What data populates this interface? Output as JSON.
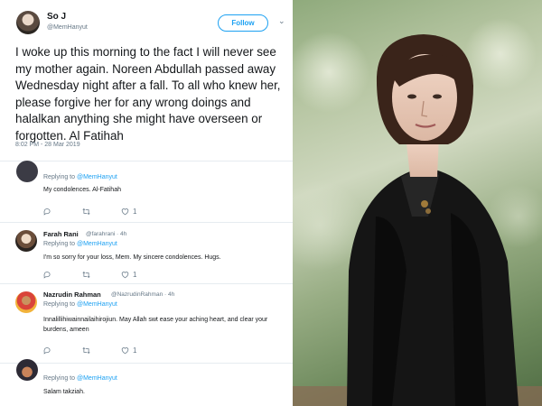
{
  "tweet": {
    "display_name": "So J",
    "handle": "@MemHanyut",
    "follow_label": "Follow",
    "text": "I woke up this morning to the fact I will never see my mother again. Noreen Abdullah passed away Wednesday night after a fall. To all who knew her, please forgive her for any wrong doings and halalkan anything she might have overseen or forgotten. Al Fatihah",
    "timestamp": "8:02 PM - 28 Mar 2019"
  },
  "replies": [
    {
      "name": "",
      "handle": "",
      "replying_prefix": "Replying to",
      "replying_to": "@MemHanyut",
      "text": "My condolences. Al-Fatihah",
      "like_count": "1"
    },
    {
      "name": "Farah Rani",
      "handle": "@farahrani · 4h",
      "replying_prefix": "Replying to",
      "replying_to": "@MemHanyut",
      "text": "I'm so sorry for your loss, Mem. My sincere condolences. Hugs.",
      "like_count": "1"
    },
    {
      "name": "Nazrudin Rahman",
      "handle": "@NazrudinRahman · 4h",
      "replying_prefix": "Replying to",
      "replying_to": "@MemHanyut",
      "text": "Innalillihiwainnailaihirojiun. May Allah swt ease your aching heart, and clear your burdens, ameen",
      "like_count": "1"
    },
    {
      "name": "",
      "handle": "",
      "replying_prefix": "Replying to",
      "replying_to": "@MemHanyut",
      "text": "Salam takziah.",
      "like_count": ""
    }
  ],
  "icons": {
    "reply": "reply-icon",
    "retweet": "retweet-icon",
    "like": "heart-icon",
    "menu": "chevron-down-icon"
  },
  "colors": {
    "accent": "#1da1f2",
    "muted": "#657786",
    "divider": "#e6ecf0"
  }
}
